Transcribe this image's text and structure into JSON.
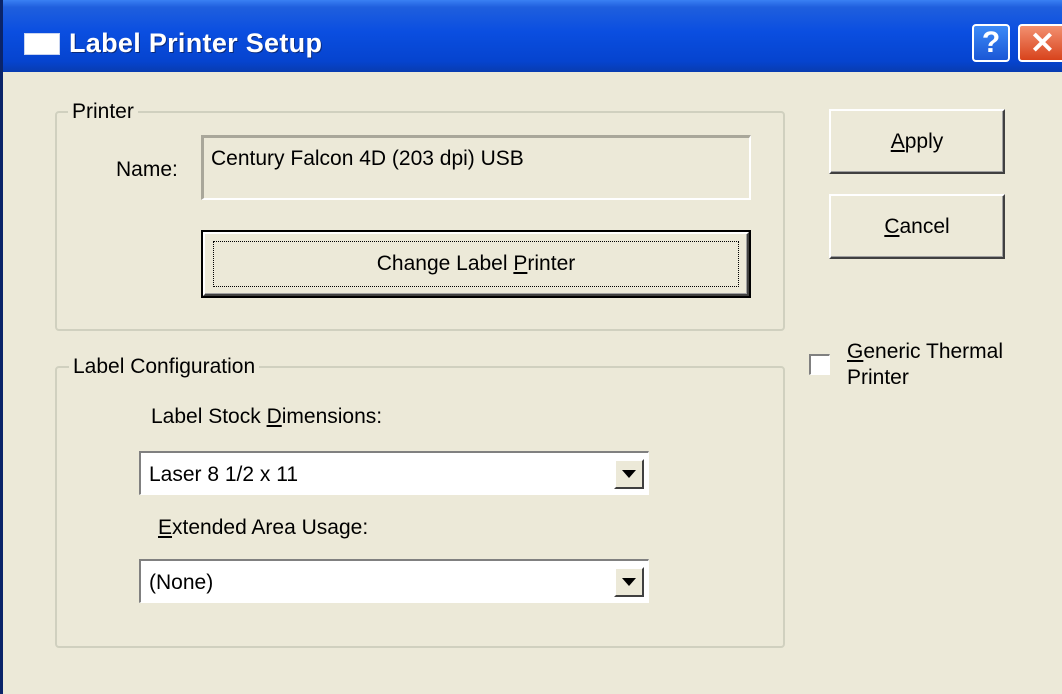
{
  "window": {
    "title": "Label Printer Setup"
  },
  "titlebar_buttons": {
    "help": "?",
    "close": "✕"
  },
  "printer_group": {
    "legend": "Printer",
    "name_label": "Name:",
    "name_value": "Century Falcon 4D (203 dpi) USB",
    "change_button": {
      "before": "Change Label ",
      "mnemonic": "P",
      "after": "rinter"
    }
  },
  "label_config_group": {
    "legend": "Label Configuration",
    "stock_label": {
      "before": "Label Stock ",
      "mnemonic": "D",
      "after": "imensions:"
    },
    "stock_value": "Laser 8 1/2 x 11",
    "extended_label": {
      "before": "",
      "mnemonic": "E",
      "after": "xtended Area Usage:"
    },
    "extended_value": "(None)"
  },
  "buttons": {
    "apply": {
      "mnemonic": "A",
      "after": "pply"
    },
    "cancel": {
      "mnemonic": "C",
      "after": "ancel"
    }
  },
  "generic_thermal": {
    "checked": false,
    "mnemonic": "G",
    "line1_after": "eneric Thermal",
    "line2": "Printer"
  }
}
